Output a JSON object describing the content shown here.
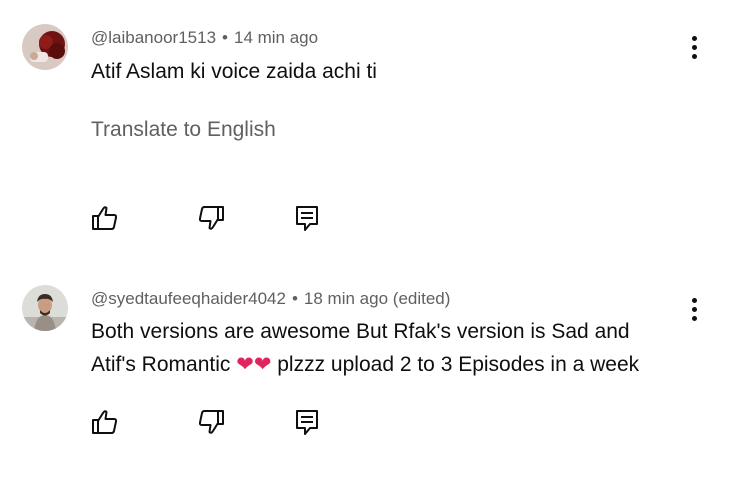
{
  "comments": [
    {
      "author": "@laibanoor1513",
      "time": "14 min ago",
      "edited": "",
      "text_lines": [
        "Atif Aslam ki voice zaida achi ti"
      ],
      "translate_label": "Translate to English"
    },
    {
      "author": "@syedtaufeeqhaider4042",
      "time": "18 min ago",
      "edited": "(edited)",
      "text_lines": [
        "Both versions are awesome But Rfak's version is Sad and",
        "Atif's Romantic ",
        "❤❤",
        " plzzz upload 2 to 3 Episodes in a week"
      ]
    }
  ],
  "separator": "•",
  "icons": {
    "like": "thumbs-up-icon",
    "dislike": "thumbs-down-icon",
    "reply": "reply-comment-icon",
    "more": "more-vertical-icon"
  },
  "colors": {
    "meta_text": "#606060",
    "body_text": "#0f0f0f",
    "heart": "#e0245e"
  }
}
